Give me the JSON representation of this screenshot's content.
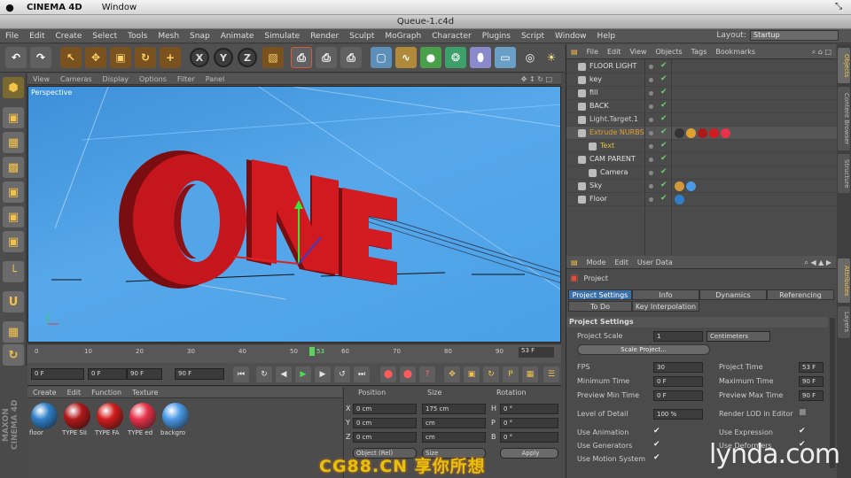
{
  "mac": {
    "apple": "",
    "app": "CINEMA 4D",
    "window_menu": "Window"
  },
  "window": {
    "title": "Queue-1.c4d"
  },
  "menubar": [
    "File",
    "Edit",
    "Create",
    "Select",
    "Tools",
    "Mesh",
    "Snap",
    "Animate",
    "Simulate",
    "Render",
    "Sculpt",
    "MoGraph",
    "Character",
    "Plugins",
    "Script",
    "Window",
    "Help"
  ],
  "layout": {
    "label": "Layout:",
    "value": "Startup"
  },
  "toolbar": {
    "axis_x": "X",
    "axis_y": "Y",
    "axis_z": "Z"
  },
  "viewport": {
    "menu": [
      "View",
      "Cameras",
      "Display",
      "Options",
      "Filter",
      "Panel"
    ],
    "label": "Perspective",
    "text3d": "ONE"
  },
  "timeline": {
    "ticks": [
      "0",
      "10",
      "20",
      "30",
      "40",
      "50",
      "60",
      "70",
      "80",
      "90"
    ],
    "current_marker": "53",
    "current_field": "53 F"
  },
  "transport": {
    "start": "0 F",
    "min": "0 F",
    "max": "90 F",
    "end": "90 F"
  },
  "materials": {
    "menu": [
      "Create",
      "Edit",
      "Function",
      "Texture"
    ],
    "items": [
      {
        "name": "floor",
        "color": "#2e7fc8"
      },
      {
        "name": "TYPE SII",
        "color": "#b01818"
      },
      {
        "name": "TYPE FA",
        "color": "#d01c1c"
      },
      {
        "name": "TYPE ed",
        "color": "#e8324a"
      },
      {
        "name": "backgro",
        "color": "#4a9ae6"
      }
    ]
  },
  "coordinates": {
    "headers": {
      "position": "Position",
      "size": "Size",
      "rotation": "Rotation"
    },
    "rows": [
      {
        "axis": "X",
        "pos": "0 cm",
        "size": "175 cm",
        "rot_axis": "H",
        "rot": "0 °"
      },
      {
        "axis": "Y",
        "pos": "0 cm",
        "size": "cm",
        "rot_axis": "P",
        "rot": "0 °"
      },
      {
        "axis": "Z",
        "pos": "0 cm",
        "size": "cm",
        "rot_axis": "B",
        "rot": "0 °"
      }
    ],
    "mode": "Object (Rel)",
    "size_mode": "Size",
    "apply": "Apply"
  },
  "objects": {
    "menu": [
      "File",
      "Edit",
      "View",
      "Objects",
      "Tags",
      "Bookmarks"
    ],
    "rows": [
      {
        "name": "FLOOR LIGHT",
        "color": "#e0e0e0"
      },
      {
        "name": "key",
        "color": "#e0e0e0"
      },
      {
        "name": "fill",
        "color": "#e0e0e0"
      },
      {
        "name": "BACK",
        "color": "#e0e0e0"
      },
      {
        "name": "Light.Target.1",
        "color": "#d0d0d0"
      },
      {
        "name": "Extrude NURBS",
        "color": "#e0a030"
      },
      {
        "name": "Text",
        "color": "#e0c040"
      },
      {
        "name": "CAM PARENT",
        "color": "#e0e0e0"
      },
      {
        "name": "Camera",
        "color": "#e0e0e0"
      },
      {
        "name": "Sky",
        "color": "#e0e0e0"
      },
      {
        "name": "Floor",
        "color": "#e0e0e0"
      }
    ]
  },
  "attributes": {
    "menu": [
      "Mode",
      "Edit",
      "User Data"
    ],
    "object": "Project",
    "tabs": [
      "Project Settings",
      "Info",
      "Dynamics",
      "Referencing",
      "To Do",
      "Key Interpolation"
    ],
    "section": "Project Settings",
    "project_scale_label": "Project Scale",
    "project_scale_value": "1",
    "project_scale_unit": "Centimeters",
    "scale_button": "Scale Project...",
    "fields": [
      {
        "label": "FPS",
        "value": "30"
      },
      {
        "label": "Minimum Time",
        "value": "0 F"
      },
      {
        "label": "Preview Min Time",
        "value": "0 F"
      },
      {
        "label": "Level of Detail",
        "value": "100 %"
      }
    ],
    "fields_right": [
      {
        "label": "Project Time",
        "value": "53 F"
      },
      {
        "label": "Maximum Time",
        "value": "90 F"
      },
      {
        "label": "Preview Max Time",
        "value": "90 F"
      }
    ],
    "render_lod": "Render LOD in Editor",
    "checks_left": [
      "Use Animation",
      "Use Generators",
      "Use Motion System"
    ],
    "checks_right": [
      "Use Expression",
      "Use Deformers"
    ]
  },
  "side_tabs": [
    "Objects",
    "Content Browser",
    "Structure",
    "Attributes",
    "Layers"
  ],
  "maxon": "MAXON CINEMA 4D",
  "watermarks": {
    "lynda": "lynda.com",
    "cg": "CG88.CN 享你所想"
  }
}
